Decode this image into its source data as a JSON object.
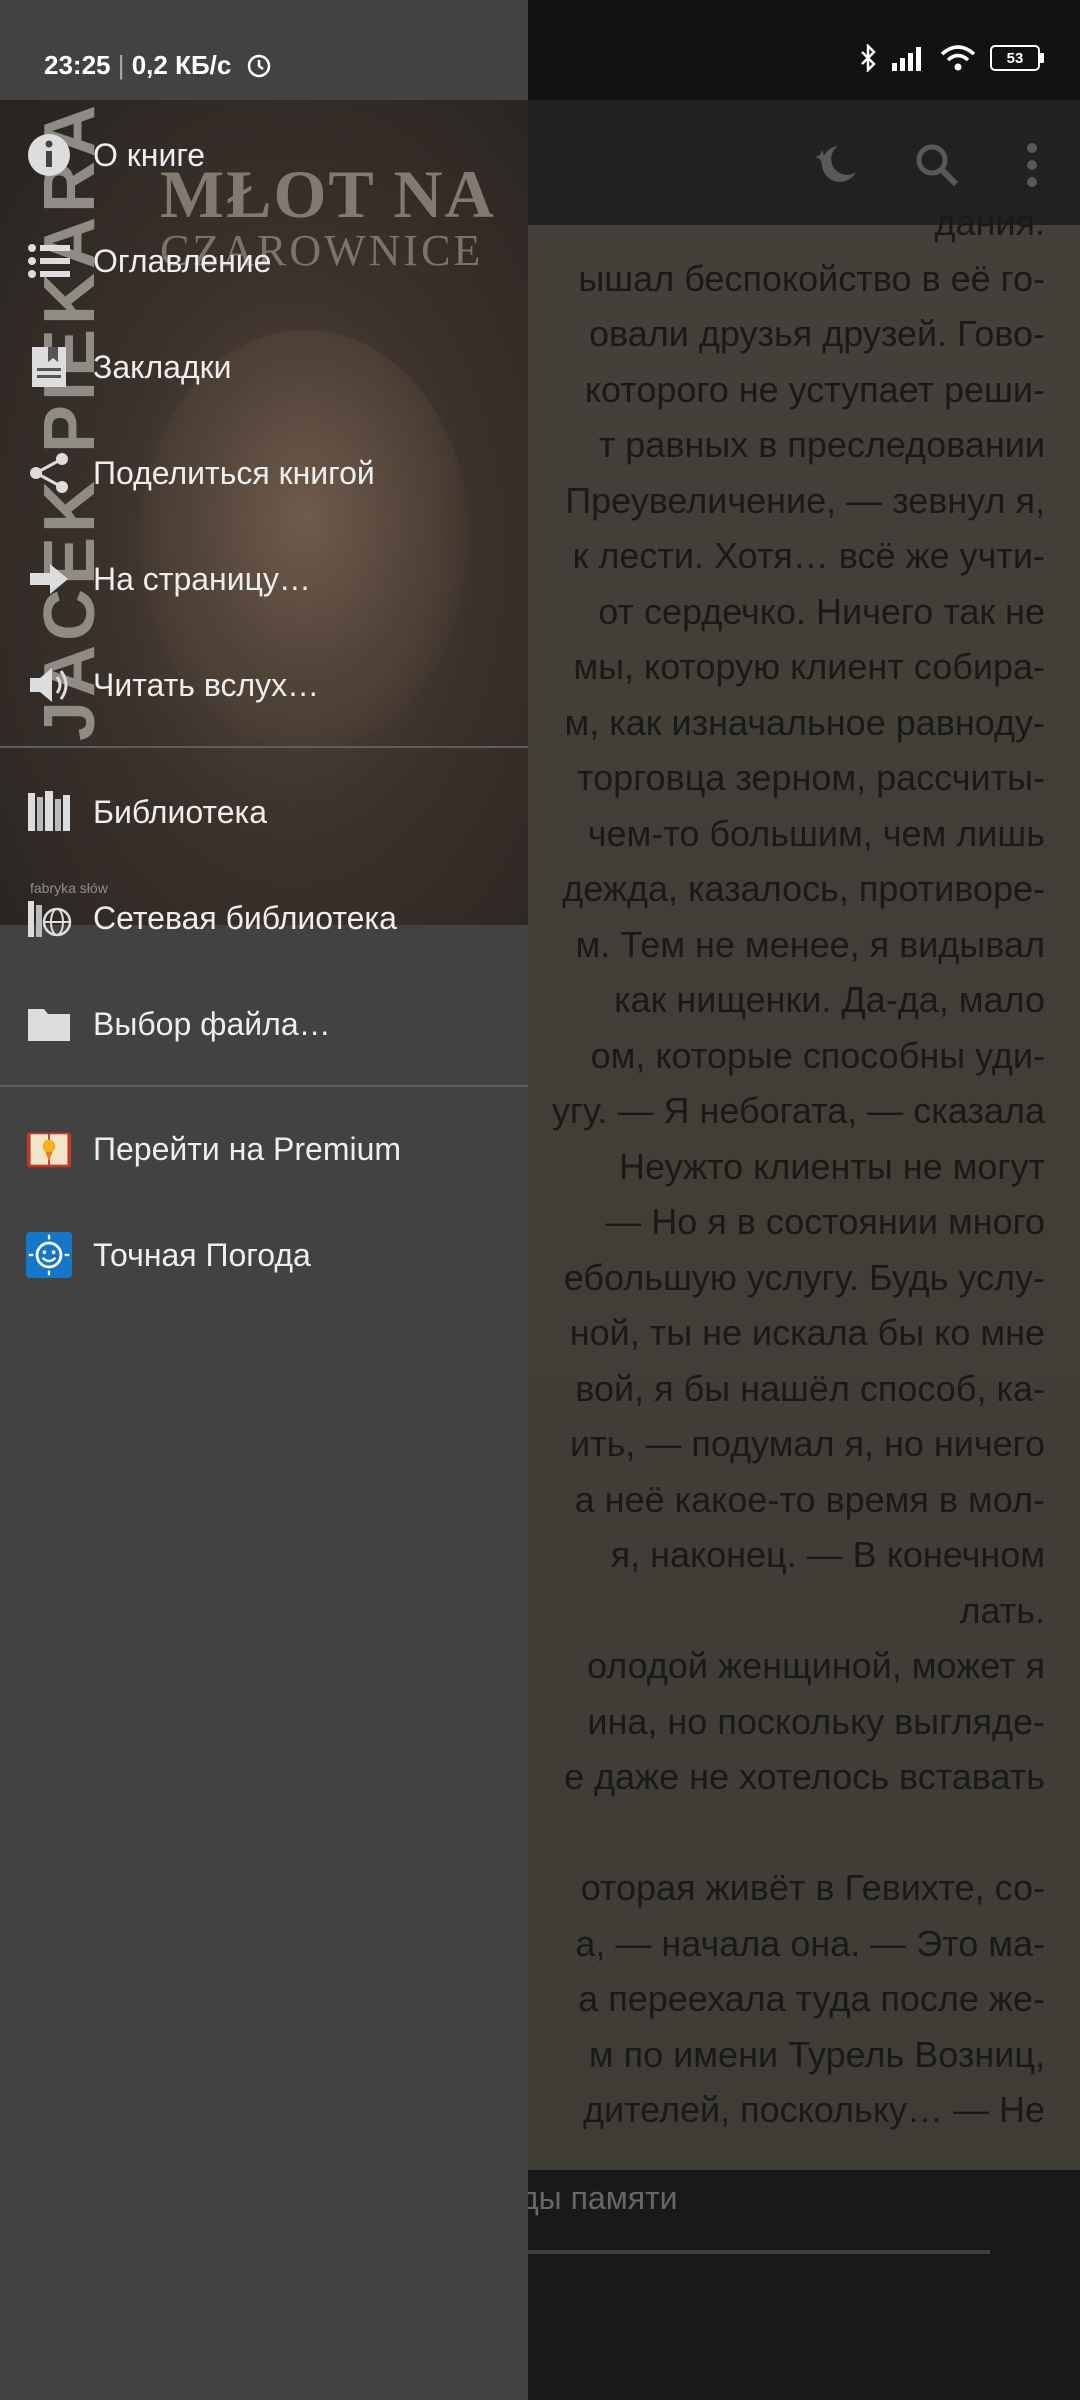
{
  "status_bar": {
    "time": "23:25",
    "network_speed": "0,2 КБ/с",
    "battery": "53"
  },
  "reader": {
    "text_lines": [
      "дания.",
      "ышал беспокойство в её го-",
      "овали друзья друзей. Гово-",
      "которого не уступает реши-",
      "т равных в преследовании",
      "Преувеличение, — зевнул я,",
      "к лести. Хотя… всё же учти-",
      "от сердечко. Ничего так не",
      "мы, которую клиент собира-",
      "м, как изначальное равноду-",
      "торговца зерном, рассчиты-",
      "чем-то большим, чем лишь",
      "дежда, казалось, противоре-",
      "м. Тем не менее, я видывал",
      "как нищенки. Да-да, мало",
      "ом, которые способны уди-",
      "угу. — Я небогата, — сказала",
      "Неужто клиенты не могут",
      "— Но я в состоянии много",
      "ебольшую услугу. Будь услу-",
      "ной, ты не искала бы ко мне",
      "вой, я бы нашёл способ, ка-",
      "ить, — подумал я, но ничего",
      "а неё какое-то время в мол-",
      "я, наконец. — В конечном",
      "лать.",
      "олодой женщиной, может я",
      "ина, но поскольку выгляде-",
      "е даже не хотелось вставать",
      "",
      "оторая живёт в Гевихте, со-",
      "а, — начала она. — Это ма-",
      "а переехала туда после же-",
      "м по имени Турель Возниц,",
      "дителей, поскольку… — Не"
    ],
    "chapter_title": "ды памяти"
  },
  "drawer": {
    "cover": {
      "title_line1": "MŁOT NA",
      "title_line2": "CZAROWNICE",
      "author": "JACEK PIEKARA",
      "publisher": "fabryka słów"
    },
    "items": [
      {
        "label": "О книге",
        "icon": "info-icon"
      },
      {
        "label": "Оглавление",
        "icon": "list-icon"
      },
      {
        "label": "Закладки",
        "icon": "bookmark-icon"
      },
      {
        "label": "Поделиться книгой",
        "icon": "share-icon"
      },
      {
        "label": "На страницу…",
        "icon": "goto-arrow-icon"
      },
      {
        "label": "Читать вслух…",
        "icon": "speaker-icon"
      },
      {
        "label": "Библиотека",
        "icon": "library-icon"
      },
      {
        "label": "Сетевая библиотека",
        "icon": "network-library-icon"
      },
      {
        "label": "Выбор файла…",
        "icon": "folder-icon"
      },
      {
        "label": "Перейти на Premium",
        "icon": "premium-book-icon"
      },
      {
        "label": "Точная Погода",
        "icon": "weather-app-icon"
      }
    ]
  }
}
